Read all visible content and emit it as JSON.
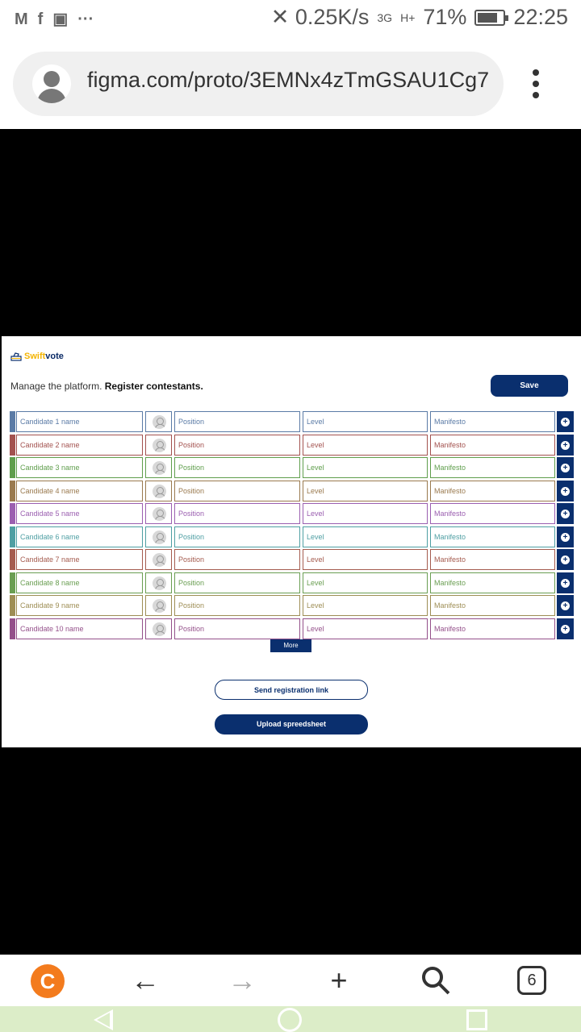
{
  "status_bar": {
    "net_speed": "✕ 0.25K/s",
    "network1": "3G",
    "network2": "H+",
    "battery": "71%",
    "time": "22:25"
  },
  "browser": {
    "url": "figma.com/proto/3EMNx4zTmGSAU1Cg7",
    "tab_count": "6"
  },
  "app": {
    "brand_first": "Swift",
    "brand_second": "vote",
    "intro_plain": "Manage the platform.",
    "intro_bold": "Register contestants.",
    "save_label": "Save",
    "more_label": "More",
    "send_link_label": "Send registration link",
    "upload_label": "Upload spreedsheet",
    "candidates": [
      {
        "name": "Candidate 1 name",
        "position": "Position",
        "level": "Level",
        "manifesto": "Manifesto",
        "color": "#5b7ba6"
      },
      {
        "name": "Candidate 2 name",
        "position": "Position",
        "level": "Level",
        "manifesto": "Manifesto",
        "color": "#a3524f"
      },
      {
        "name": "Candidate 3 name",
        "position": "Position",
        "level": "Level",
        "manifesto": "Manifesto",
        "color": "#5f9e4c"
      },
      {
        "name": "Candidate 4 name",
        "position": "Position",
        "level": "Level",
        "manifesto": "Manifesto",
        "color": "#9a7a4f"
      },
      {
        "name": "Candidate 5 name",
        "position": "Position",
        "level": "Level",
        "manifesto": "Manifesto",
        "color": "#9b5fb0"
      },
      {
        "name": "Candidate 6 name",
        "position": "Position",
        "level": "Level",
        "manifesto": "Manifesto",
        "color": "#4f9fa3"
      },
      {
        "name": "Candidate 7 name",
        "position": "Position",
        "level": "Level",
        "manifesto": "Manifesto",
        "color": "#a55c4f"
      },
      {
        "name": "Candidate 8 name",
        "position": "Position",
        "level": "Level",
        "manifesto": "Manifesto",
        "color": "#6a9e52"
      },
      {
        "name": "Candidate 9 name",
        "position": "Position",
        "level": "Level",
        "manifesto": "Manifesto",
        "color": "#9e8e55"
      },
      {
        "name": "Candidate 10 name",
        "position": "Position",
        "level": "Level",
        "manifesto": "Manifesto",
        "color": "#94508a"
      }
    ]
  },
  "colors": {
    "primary": "#0a2f6e",
    "brand_accent": "#f4b400"
  }
}
